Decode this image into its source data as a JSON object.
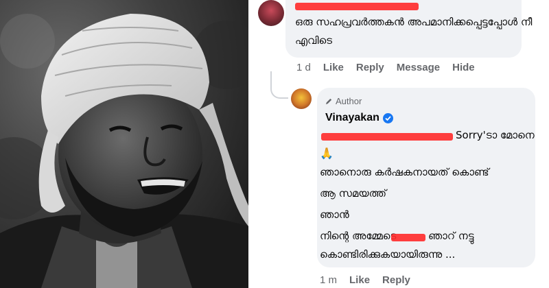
{
  "top_comment": {
    "text_line1": "ഒരു സഹപ്രവർത്തകൻ അപമാനിക്കപ്പെട്ടപ്പോൾ നീ",
    "text_line2": "എവിടെ",
    "time": "1 d",
    "like_label": "Like",
    "reply_label": "Reply",
    "message_label": "Message",
    "hide_label": "Hide"
  },
  "author_comment": {
    "badge_label": "Author",
    "name": "Vinayakan",
    "line1_suffix": "Sorry'ടാ മോനെ",
    "emoji": "🙏",
    "line2": "ഞാനൊരു കർഷകനായത് കൊണ്ട്",
    "line3": "ആ സമയത്ത്",
    "line4": "ഞാൻ",
    "line5_start": "നിന്റെ അമ്മേടെ",
    "line5_end": "ഞാറ് നട്ടു",
    "line6": "കൊണ്ടിരിക്കുകയായിരുന്നു ...",
    "time": "1 m",
    "like_label": "Like",
    "reply_label": "Reply"
  },
  "colors": {
    "bubble": "#f0f2f5",
    "action_text": "#65676b",
    "verified": "#1877f2",
    "redaction": "#ff2a2a"
  }
}
